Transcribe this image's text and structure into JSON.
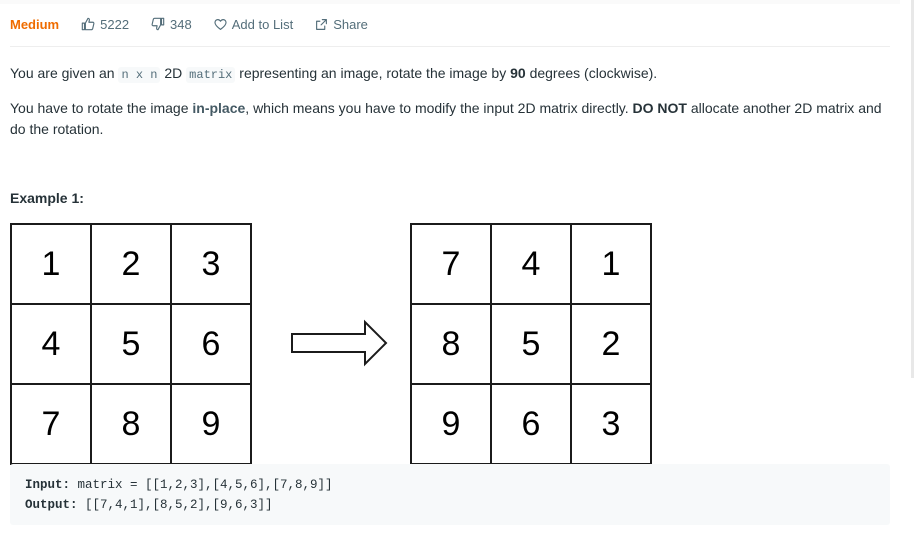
{
  "header": {
    "difficulty": "Medium",
    "likes": "5222",
    "dislikes": "348",
    "add_to_list": "Add to List",
    "share": "Share"
  },
  "description": {
    "p1_a": "You are given an ",
    "p1_code1": "n x n",
    "p1_b": " 2D ",
    "p1_code2": "matrix",
    "p1_c": " representing an image, rotate the image by ",
    "p1_bold": "90",
    "p1_d": " degrees (clockwise).",
    "p2_a": "You have to rotate the image ",
    "p2_link": "in-place",
    "p2_b": ", which means you have to modify the input 2D matrix directly. ",
    "p2_bold": "DO NOT",
    "p2_c": " allocate another 2D matrix and do the rotation."
  },
  "example": {
    "title": "Example 1:",
    "input_grid": [
      [
        "1",
        "2",
        "3"
      ],
      [
        "4",
        "5",
        "6"
      ],
      [
        "7",
        "8",
        "9"
      ]
    ],
    "output_grid": [
      [
        "7",
        "4",
        "1"
      ],
      [
        "8",
        "5",
        "2"
      ],
      [
        "9",
        "6",
        "3"
      ]
    ],
    "input_label": "Input:",
    "input_value": " matrix = [[1,2,3],[4,5,6],[7,8,9]]",
    "output_label": "Output:",
    "output_value": " [[7,4,1],[8,5,2],[9,6,3]]"
  },
  "icons": {
    "like": "thumbs-up-icon",
    "dislike": "thumbs-down-icon",
    "add_to_list": "heart-icon",
    "share": "share-icon",
    "arrow": "right-arrow-icon"
  },
  "colors": {
    "difficulty_medium": "#ef6c00",
    "meta_text": "#546e7a",
    "code_background": "#f7f9fa"
  }
}
